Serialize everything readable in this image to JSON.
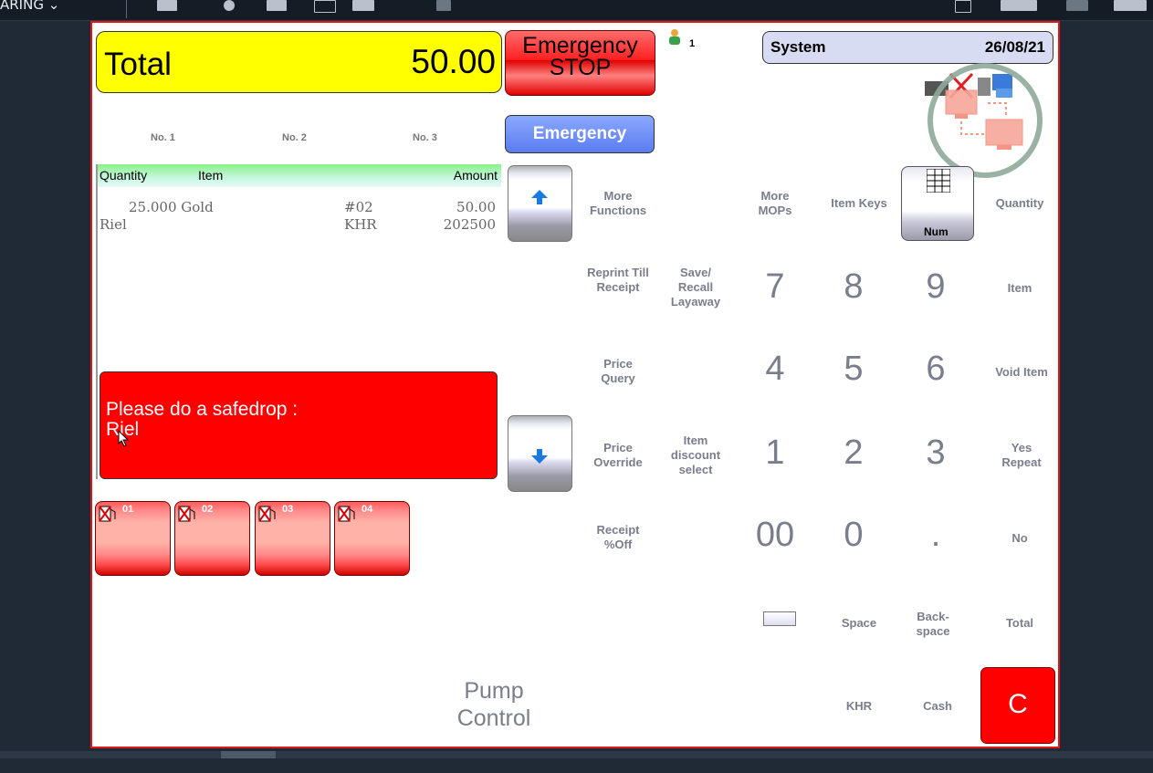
{
  "topbar": {
    "label": "ARING ⌄"
  },
  "header": {
    "total_label": "Total",
    "total_value": "50.00",
    "emergency_stop_line1": "Emergency",
    "emergency_stop_line2": "STOP",
    "users_logged": "1",
    "system_label": "System",
    "date": "26/08/21",
    "emergency_label": "Emergency"
  },
  "tabs": [
    "No. 1",
    "No. 2",
    "No. 3"
  ],
  "list": {
    "headers": {
      "quantity": "Quantity",
      "item": "Item",
      "amount": "Amount"
    },
    "rows": [
      {
        "qty_item": "25.000 Gold",
        "code": "#02",
        "amount": "50.00"
      },
      {
        "qty_item": "Riel",
        "code": "KHR",
        "amount": "202500"
      }
    ]
  },
  "message": {
    "line1": "Please do a safedrop :",
    "line2": "Riel"
  },
  "pumps": [
    "01",
    "02",
    "03",
    "04"
  ],
  "keys": {
    "more_functions": "More Functions",
    "more_mops": "More MOPs",
    "item_keys": "Item Keys",
    "num": "Num",
    "quantity": "Quantity",
    "reprint": "Reprint Till Receipt",
    "save_recall": "Save/ Recall Layaway",
    "item": "Item",
    "price_query": "Price Query",
    "void_item": "Void Item",
    "price_override": "Price Override",
    "item_discount": "Item discount select",
    "yes_repeat": "Yes Repeat",
    "receipt_off": "Receipt %Off",
    "no": "No",
    "space": "Space",
    "backspace": "Back- space",
    "total": "Total",
    "khr": "KHR",
    "cash": "Cash",
    "clear": "C",
    "pump_control": "Pump Control"
  },
  "digits": {
    "d7": "7",
    "d8": "8",
    "d9": "9",
    "d4": "4",
    "d5": "5",
    "d6": "6",
    "d1": "1",
    "d2": "2",
    "d3": "3",
    "d00": "00",
    "d0": "0",
    "dot": "."
  },
  "colors": {
    "total_bg": "#ffff00",
    "alert_red": "#ff0000",
    "system_bg": "#d8dcf2",
    "emergency_blue": "#6a8cf8"
  }
}
